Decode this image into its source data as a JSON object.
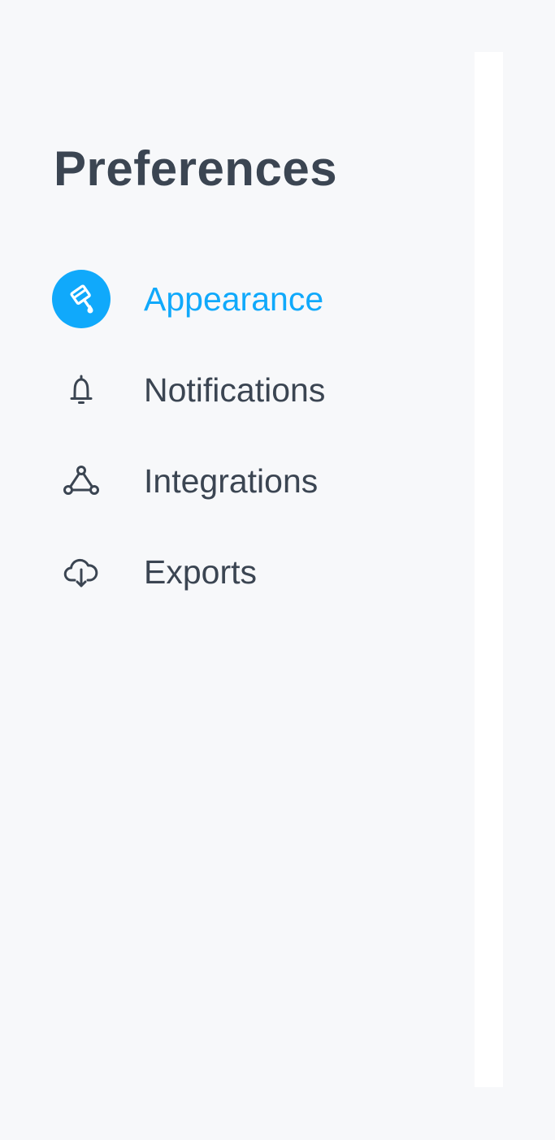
{
  "sidebar": {
    "title": "Preferences",
    "active_color": "#10a9fb",
    "items": [
      {
        "label": "Appearance",
        "icon": "paint-bucket-icon",
        "active": true
      },
      {
        "label": "Notifications",
        "icon": "bell-icon",
        "active": false
      },
      {
        "label": "Integrations",
        "icon": "integrations-icon",
        "active": false
      },
      {
        "label": "Exports",
        "icon": "cloud-download-icon",
        "active": false
      }
    ]
  }
}
